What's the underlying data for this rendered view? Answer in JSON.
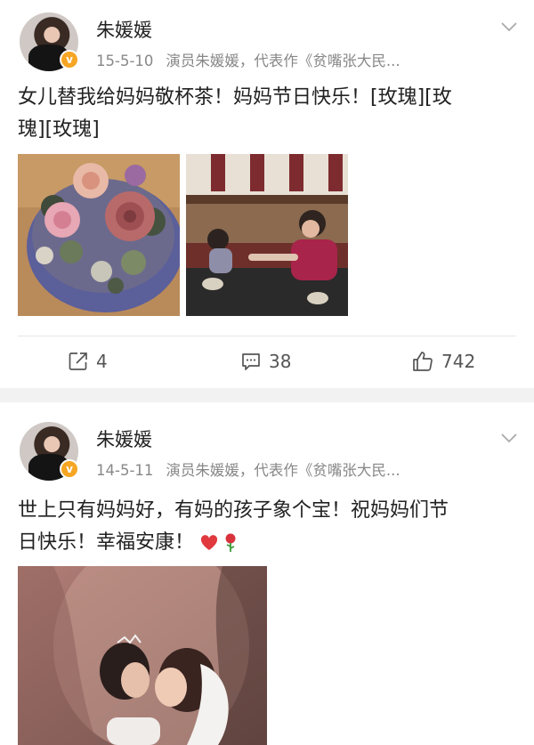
{
  "posts": [
    {
      "author": "朱媛媛",
      "date": "15-5-10",
      "source": "演员朱媛媛，代表作《贫嘴张大民...",
      "text_line1": "女儿替我给妈妈敬杯茶！妈妈节日快乐！[玫瑰][玫",
      "text_line2": "瑰][玫瑰]",
      "images": [
        "rose-flower-box-photo",
        "girl-serving-tea-to-grandmother-photo"
      ],
      "reposts": "4",
      "comments": "38",
      "likes": "742"
    },
    {
      "author": "朱媛媛",
      "date": "14-5-11",
      "source": "演员朱媛媛，代表作《贫嘴张大民...",
      "text_line1": "世上只有妈妈好，有妈的孩子象个宝！祝妈妈们节",
      "text_line2": "日快乐！幸福安康！",
      "images": [
        "mother-kissing-daughter-photo"
      ]
    }
  ],
  "colors": {
    "text": "#222222",
    "meta": "#888888",
    "verified_badge": "#f6a623",
    "divider": "#e6e6e6",
    "background_gap": "#f2f2f2",
    "heart": "#e0393e"
  },
  "icons": [
    "chevron-down-icon",
    "verified-badge-icon",
    "repost-icon",
    "comment-icon",
    "like-icon",
    "heart-emoji-icon",
    "rose-emoji-icon"
  ]
}
